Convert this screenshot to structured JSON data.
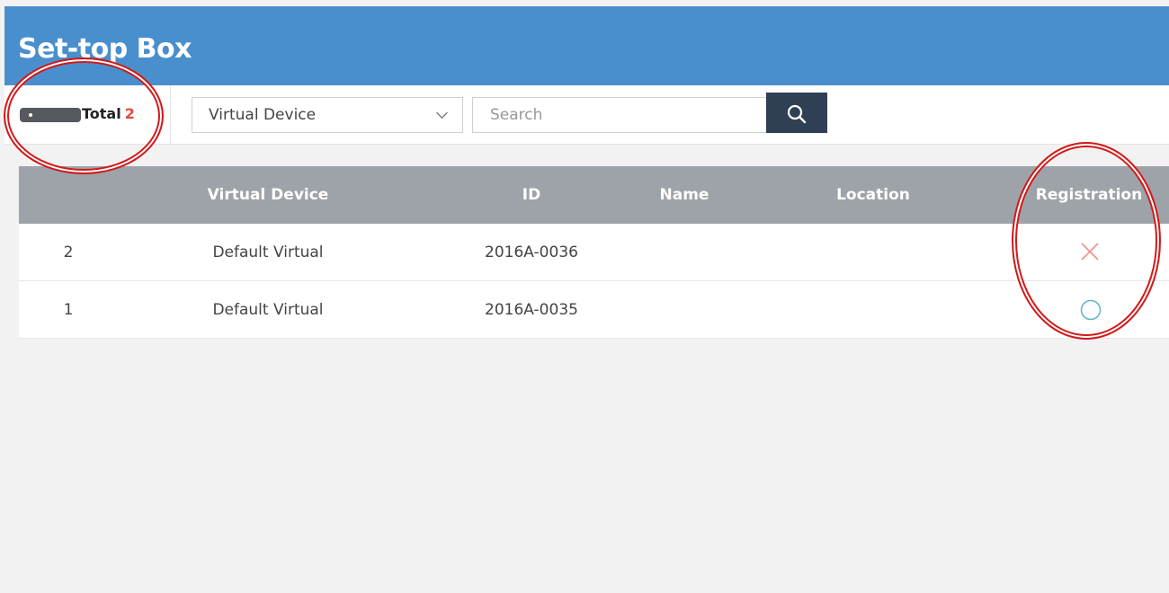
{
  "header": {
    "title": "Set-top Box"
  },
  "toolbar": {
    "device_icon": "set-top-box-icon",
    "total_label": "Total",
    "total_count": "2",
    "filter_select": {
      "value": "Virtual Device",
      "icon": "chevron-down-icon"
    },
    "search": {
      "placeholder": "Search",
      "value": "",
      "icon": "search-icon"
    }
  },
  "table": {
    "columns": [
      "",
      "Virtual Device",
      "ID",
      "Name",
      "Location",
      "Registration"
    ],
    "rows": [
      {
        "num": "2",
        "virtual_device": "Default Virtual",
        "id": "2016A-0036",
        "name": "",
        "location": "",
        "registration": "not-registered",
        "registration_icon": "x-icon"
      },
      {
        "num": "1",
        "virtual_device": "Default Virtual",
        "id": "2016A-0035",
        "name": "",
        "location": "",
        "registration": "registered",
        "registration_icon": "circle-icon"
      }
    ]
  },
  "colors": {
    "header_bg": "#4a8fcd",
    "table_header_bg": "#9ea3a9",
    "search_button_bg": "#2f3f54",
    "total_count": "#e24b3e",
    "x_icon": "#ef8f8a",
    "circle_icon": "#5bb5c9",
    "annotation": "#d11a1a"
  }
}
